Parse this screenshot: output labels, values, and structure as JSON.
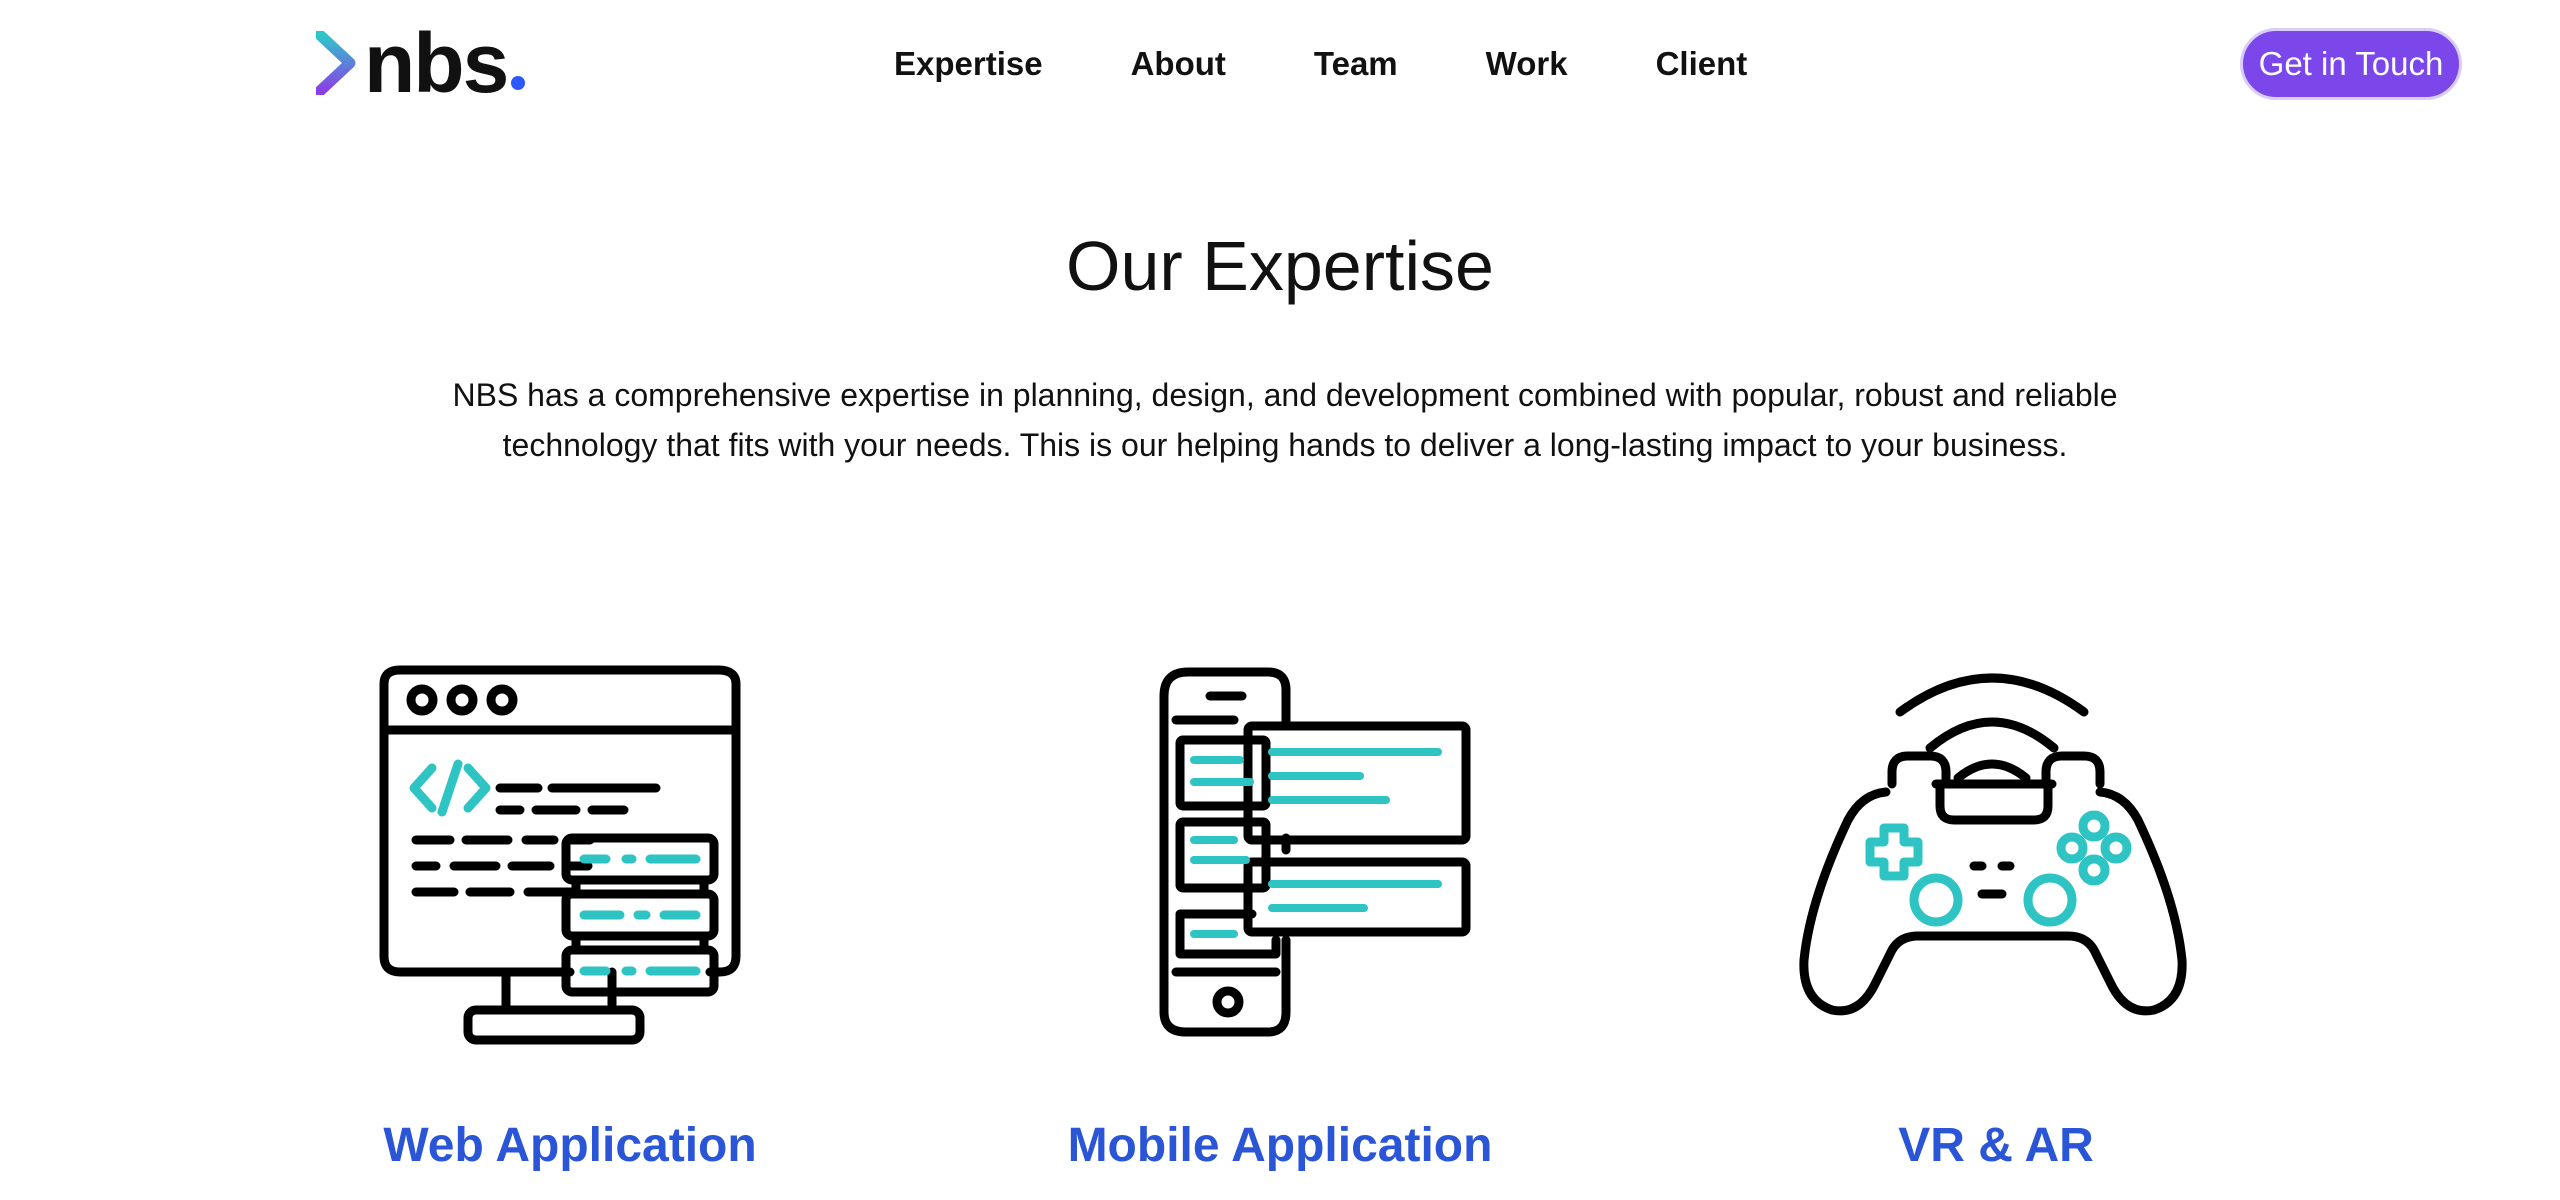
{
  "brand": {
    "name": "nbs",
    "colors": {
      "chevron_top": "#2ec7c9",
      "chevron_bottom": "#8a3ee8",
      "dot": "#2b59ff"
    }
  },
  "nav": {
    "items": [
      {
        "label": "Expertise"
      },
      {
        "label": "About"
      },
      {
        "label": "Team"
      },
      {
        "label": "Work"
      },
      {
        "label": "Client"
      }
    ]
  },
  "cta": {
    "label": "Get in Touch",
    "color": "#7c47ea"
  },
  "section": {
    "title": "Our Expertise",
    "description": "NBS has a comprehensive expertise in planning, design, and development combined with popular, robust and reliable technology that fits with your needs. This is our helping hands to deliver a long-lasting impact to your business."
  },
  "expertise": {
    "accent_color": "#2ec4c4",
    "title_color": "#2a55d6",
    "items": [
      {
        "title": "Web Application",
        "icon": "web-development-icon"
      },
      {
        "title": "Mobile Application",
        "icon": "mobile-app-icon"
      },
      {
        "title": "VR & AR",
        "icon": "game-controller-icon"
      }
    ]
  }
}
